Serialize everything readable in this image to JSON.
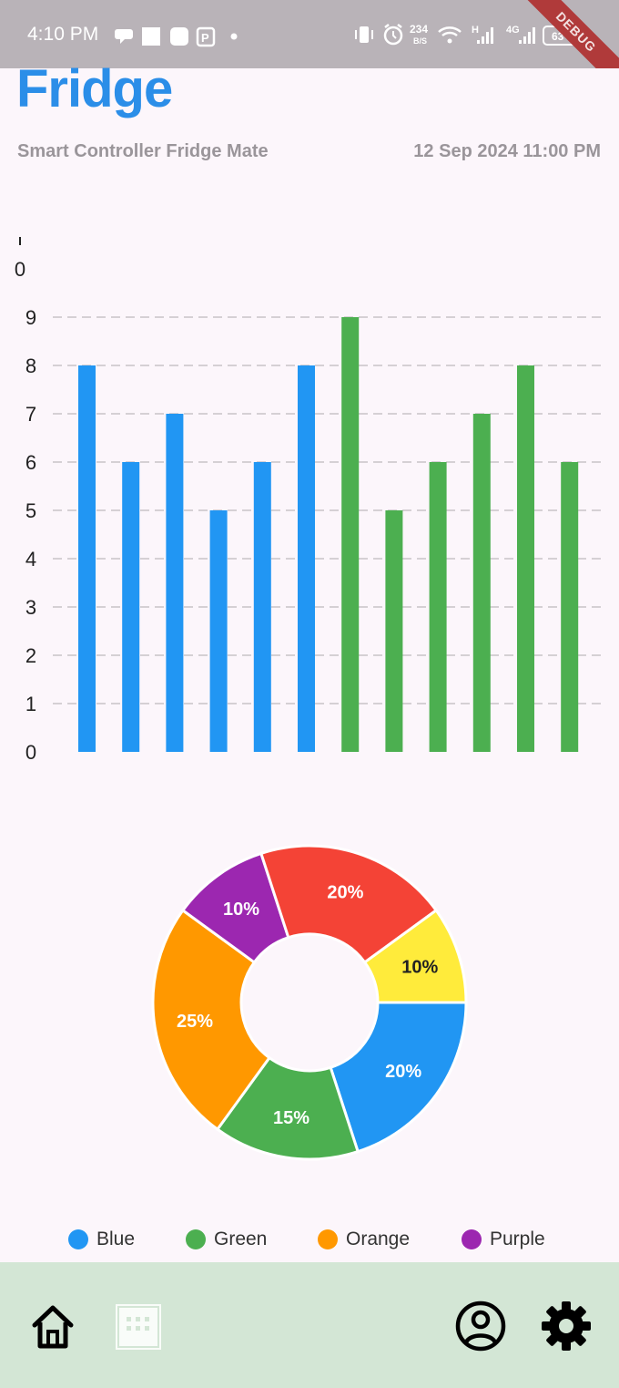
{
  "status_bar": {
    "time": "4:10 PM",
    "net_speed_top": "234",
    "net_speed_bottom": "B/S",
    "network_label_1": "H",
    "network_label_2": "4G",
    "battery": "63",
    "debug_banner": "DEBUG",
    "icons": [
      "chat-bubble-icon",
      "square-icon",
      "rounded-square-icon",
      "parking-icon",
      "dot-icon",
      "vibrate-icon",
      "alarm-icon",
      "wifi-icon",
      "signal-icon",
      "signal-4g-icon",
      "battery-icon"
    ]
  },
  "header": {
    "title": "Fridge",
    "subtitle": "Smart Controller Fridge Mate",
    "datetime": "12 Sep 2024 11:00 PM"
  },
  "colors": {
    "blue": "#2196f3",
    "green": "#4caf50",
    "orange": "#ff9800",
    "purple": "#9c27b0",
    "red": "#f44336",
    "yellow": "#ffeb3b",
    "title": "#2b8ee8",
    "nav_bg": "#d3e6d5"
  },
  "chart_data": [
    {
      "type": "bar",
      "values": [
        8,
        6,
        7,
        5,
        6,
        8,
        9,
        5,
        6,
        7,
        8,
        6
      ],
      "bar_colors": [
        "blue",
        "blue",
        "blue",
        "blue",
        "blue",
        "blue",
        "green",
        "green",
        "green",
        "green",
        "green",
        "green"
      ],
      "y_ticks": [
        "0",
        "1",
        "2",
        "3",
        "4",
        "5",
        "6",
        "7",
        "8",
        "9"
      ],
      "top_tick_label": "0",
      "ylim": [
        0,
        10
      ],
      "grid": "horizontal dashed"
    },
    {
      "type": "pie",
      "style": "donut",
      "slices": [
        {
          "label": "20%",
          "value": 20,
          "color": "#2196f3"
        },
        {
          "label": "15%",
          "value": 15,
          "color": "#4caf50"
        },
        {
          "label": "25%",
          "value": 25,
          "color": "#ff9800"
        },
        {
          "label": "10%",
          "value": 10,
          "color": "#9c27b0"
        },
        {
          "label": "20%",
          "value": 20,
          "color": "#f44336"
        },
        {
          "label": "10%",
          "value": 10,
          "color": "#ffeb3b"
        }
      ]
    }
  ],
  "legend": [
    {
      "label": "Blue",
      "color": "#2196f3"
    },
    {
      "label": "Green",
      "color": "#4caf50"
    },
    {
      "label": "Orange",
      "color": "#ff9800"
    },
    {
      "label": "Purple",
      "color": "#9c27b0"
    }
  ],
  "bottom_nav": {
    "items": [
      "home-icon",
      "grid-icon",
      "account-icon",
      "settings-icon"
    ]
  }
}
